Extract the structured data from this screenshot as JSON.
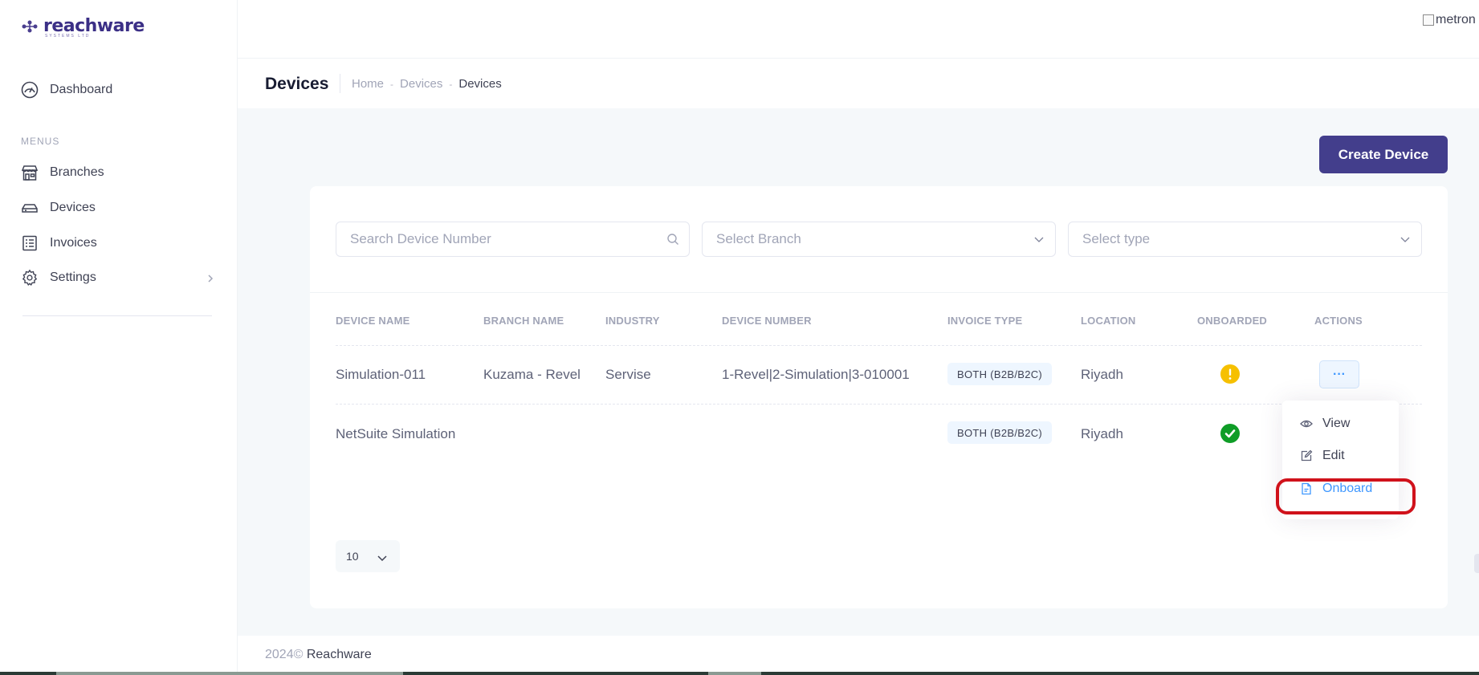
{
  "app": {
    "logo_text": "reachware",
    "logo_sub": "SYSTEMS LTD",
    "avatar_alt": "metron"
  },
  "sidebar": {
    "dashboard_label": "Dashboard",
    "menus_title": "MENUS",
    "items": [
      {
        "label": "Branches",
        "icon": "store-icon"
      },
      {
        "label": "Devices",
        "icon": "device-icon"
      },
      {
        "label": "Invoices",
        "icon": "invoice-icon"
      },
      {
        "label": "Settings",
        "icon": "gear-icon"
      }
    ]
  },
  "toolbar": {
    "title": "Devices",
    "breadcrumb": [
      "Home",
      "Devices",
      "Devices"
    ]
  },
  "create_button": "Create Device",
  "filters": {
    "search_placeholder": "Search Device Number",
    "branch_placeholder": "Select Branch",
    "type_placeholder": "Select type"
  },
  "table": {
    "headers": [
      "DEVICE NAME",
      "BRANCH NAME",
      "INDUSTRY",
      "DEVICE NUMBER",
      "INVOICE TYPE",
      "LOCATION",
      "ONBOARDED",
      "ACTIONS"
    ],
    "rows": [
      {
        "device_name": "Simulation-011",
        "branch_name": "Kuzama - Revel",
        "industry": "Servise",
        "device_number": "1-Revel|2-Simulation|3-010001",
        "invoice_type": "BOTH (B2B/B2C)",
        "location": "Riyadh",
        "onboarded": "warning"
      },
      {
        "device_name": "NetSuite Simulation",
        "branch_name": "",
        "industry": "",
        "device_number": "",
        "invoice_type": "BOTH (B2B/B2C)",
        "location": "Riyadh",
        "onboarded": "success"
      }
    ]
  },
  "actions_button": "···",
  "action_menu": {
    "view": "View",
    "edit": "Edit",
    "onboard": "Onboard"
  },
  "pagination": {
    "page_size": "10"
  },
  "footer": {
    "year": "2024©",
    "company": "Reachware"
  },
  "colors": {
    "primary": "#433e8c",
    "accent": "#3e97ff",
    "warning": "#f6c000",
    "success": "#0f9d27",
    "highlight": "#d0121b"
  }
}
